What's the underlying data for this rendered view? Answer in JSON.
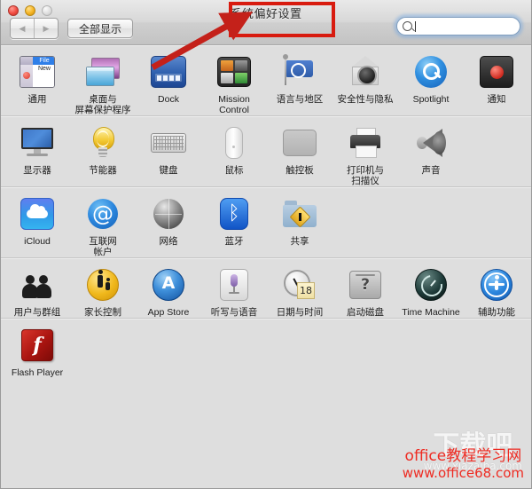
{
  "window": {
    "title": "系统偏好设置",
    "traffic_lights": [
      "close",
      "minimize",
      "zoom"
    ]
  },
  "toolbar": {
    "back_icon": "chevron-left-icon",
    "forward_icon": "chevron-right-icon",
    "show_all_label": "全部显示",
    "search": {
      "icon": "search-icon",
      "value": "",
      "placeholder": ""
    }
  },
  "rows": [
    {
      "items": [
        {
          "label": "通用",
          "icon": "general-icon"
        },
        {
          "label": "桌面与\n屏幕保护程序",
          "icon": "desktop-screensaver-icon"
        },
        {
          "label": "Dock",
          "icon": "dock-icon"
        },
        {
          "label": "Mission\nControl",
          "icon": "mission-control-icon"
        },
        {
          "label": "语言与地区",
          "icon": "language-region-icon"
        },
        {
          "label": "安全性与隐私",
          "icon": "security-privacy-icon"
        },
        {
          "label": "Spotlight",
          "icon": "spotlight-icon"
        },
        {
          "label": "通知",
          "icon": "notifications-icon"
        }
      ]
    },
    {
      "items": [
        {
          "label": "显示器",
          "icon": "displays-icon"
        },
        {
          "label": "节能器",
          "icon": "energy-saver-icon"
        },
        {
          "label": "键盘",
          "icon": "keyboard-icon"
        },
        {
          "label": "鼠标",
          "icon": "mouse-icon"
        },
        {
          "label": "触控板",
          "icon": "trackpad-icon"
        },
        {
          "label": "打印机与\n扫描仪",
          "icon": "printers-scanners-icon"
        },
        {
          "label": "声音",
          "icon": "sound-icon"
        }
      ]
    },
    {
      "items": [
        {
          "label": "iCloud",
          "icon": "icloud-icon"
        },
        {
          "label": "互联网\n帐户",
          "icon": "internet-accounts-icon"
        },
        {
          "label": "网络",
          "icon": "network-icon"
        },
        {
          "label": "蓝牙",
          "icon": "bluetooth-icon"
        },
        {
          "label": "共享",
          "icon": "sharing-icon"
        }
      ]
    },
    {
      "items": [
        {
          "label": "用户与群组",
          "icon": "users-groups-icon"
        },
        {
          "label": "家长控制",
          "icon": "parental-controls-icon"
        },
        {
          "label": "App Store",
          "icon": "app-store-icon"
        },
        {
          "label": "听写与语音",
          "icon": "dictation-speech-icon"
        },
        {
          "label": "日期与时间",
          "icon": "date-time-icon"
        },
        {
          "label": "启动磁盘",
          "icon": "startup-disk-icon"
        },
        {
          "label": "Time Machine",
          "icon": "time-machine-icon"
        },
        {
          "label": "辅助功能",
          "icon": "accessibility-icon"
        }
      ]
    },
    {
      "items": [
        {
          "label": "Flash Player",
          "icon": "flash-player-icon"
        }
      ]
    }
  ],
  "icon_details": {
    "general_menu_title": "File",
    "general_menu_item": "New",
    "internet_accounts_glyph": "@",
    "bluetooth_glyph": "ᛒ",
    "app_store_glyph": "A",
    "date_time_day": "18",
    "startup_disk_glyph": "?",
    "flash_glyph": "f"
  },
  "annotation": {
    "highlight_target": "系统偏好设置",
    "box_color": "#d81b0f",
    "arrow_color": "#c4211a"
  },
  "watermark": {
    "site_name": "office教程学习网",
    "site_url": "www.office68.com",
    "ghost_name": "下载吧",
    "ghost_url": "www.xiazaiba.com",
    "color": "#ee2b22"
  }
}
